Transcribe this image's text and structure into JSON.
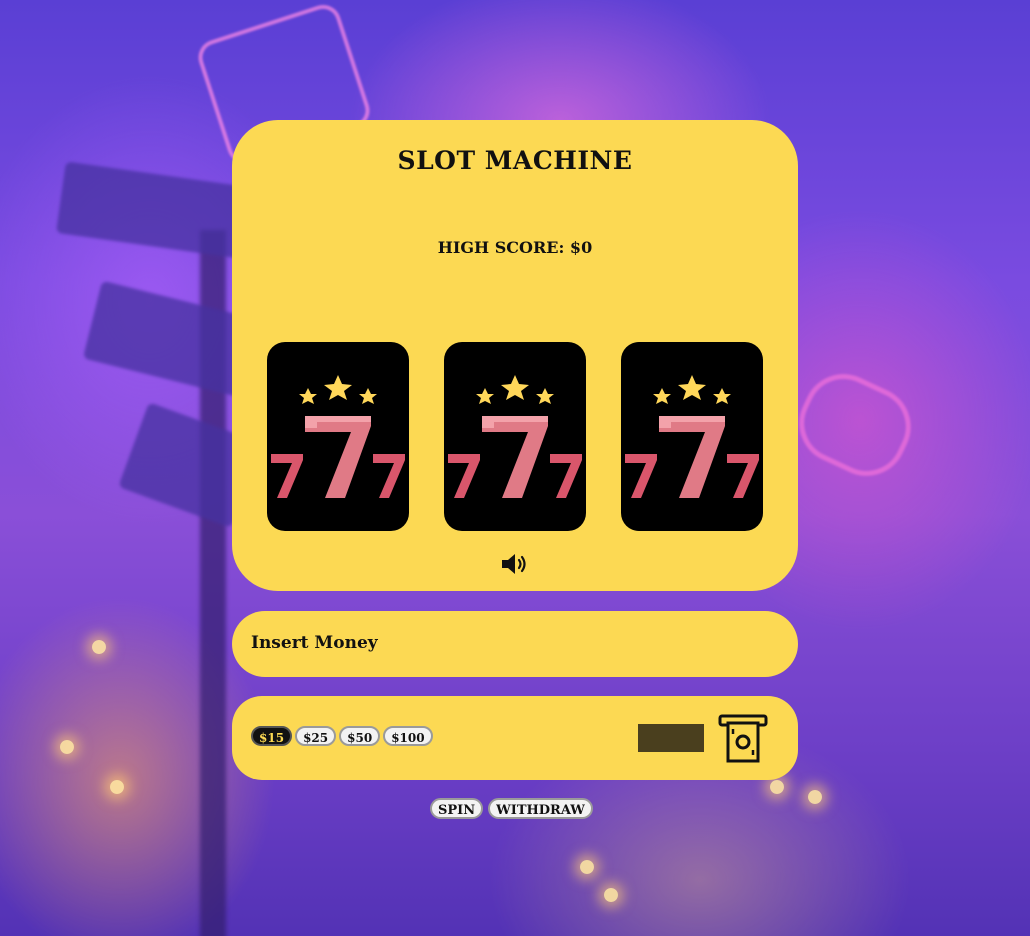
{
  "game": {
    "title": "SLOT MACHINE",
    "high_score_label": "HIGH SCORE: $0"
  },
  "reels": [
    {
      "symbol": "triple-seven-stars-icon"
    },
    {
      "symbol": "triple-seven-stars-icon"
    },
    {
      "symbol": "triple-seven-stars-icon"
    }
  ],
  "sound": {
    "icon": "speaker-volume-icon"
  },
  "insert_money": {
    "label": "Insert Money"
  },
  "bets": {
    "options": [
      "$15",
      "$25",
      "$50",
      "$100"
    ],
    "selected": "$15"
  },
  "cash_icon": "cash-bill-icon",
  "actions": {
    "spin_label": "SPIN",
    "withdraw_label": "WITHDRAW"
  },
  "colors": {
    "panel": "#fcd953",
    "reel_background": "#000000",
    "seven_red": "#d9566b",
    "star_yellow": "#ffd75a"
  }
}
